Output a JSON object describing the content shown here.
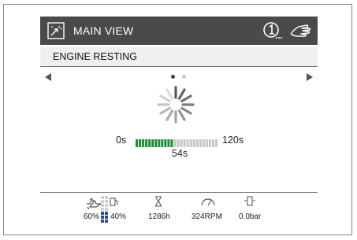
{
  "header": {
    "title": "MAIN VIEW"
  },
  "status": {
    "text": "ENGINE RESTING"
  },
  "pager": {
    "current_page": 1,
    "page_count": 2
  },
  "timer": {
    "min_label": "0s",
    "max_label": "120s",
    "value_label": "54s",
    "progress_fraction": 0.45,
    "filled_color": "#1f8f3a",
    "empty_color": "#c8c8c8"
  },
  "gauges": {
    "fuel": {
      "icon": "fuel-pump-icon",
      "label": "60%"
    },
    "def": {
      "icon": "def-tank-icon",
      "label": "40%",
      "level_color": "#1e4fae"
    },
    "hours": {
      "icon": "hourglass-icon",
      "label": "1286h"
    },
    "rpm": {
      "icon": "tachometer-icon",
      "label": "324RPM"
    },
    "pressure": {
      "icon": "pressure-sensor-icon",
      "label": "0.0bar"
    }
  },
  "colors": {
    "titlebar_bg": "#4a4a4a",
    "status_bg": "#efefef"
  }
}
